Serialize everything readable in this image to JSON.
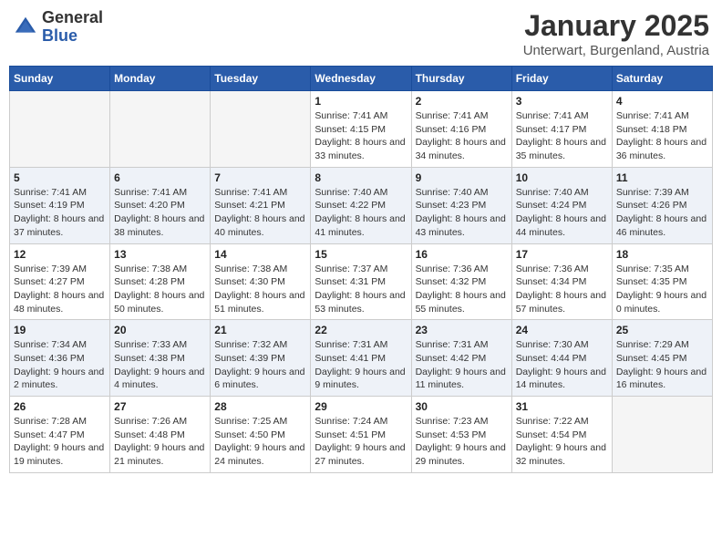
{
  "header": {
    "logo_general": "General",
    "logo_blue": "Blue",
    "title": "January 2025",
    "subtitle": "Unterwart, Burgenland, Austria"
  },
  "weekdays": [
    "Sunday",
    "Monday",
    "Tuesday",
    "Wednesday",
    "Thursday",
    "Friday",
    "Saturday"
  ],
  "weeks": [
    [
      {
        "day": "",
        "sunrise": "",
        "sunset": "",
        "daylight": ""
      },
      {
        "day": "",
        "sunrise": "",
        "sunset": "",
        "daylight": ""
      },
      {
        "day": "",
        "sunrise": "",
        "sunset": "",
        "daylight": ""
      },
      {
        "day": "1",
        "sunrise": "Sunrise: 7:41 AM",
        "sunset": "Sunset: 4:15 PM",
        "daylight": "Daylight: 8 hours and 33 minutes."
      },
      {
        "day": "2",
        "sunrise": "Sunrise: 7:41 AM",
        "sunset": "Sunset: 4:16 PM",
        "daylight": "Daylight: 8 hours and 34 minutes."
      },
      {
        "day": "3",
        "sunrise": "Sunrise: 7:41 AM",
        "sunset": "Sunset: 4:17 PM",
        "daylight": "Daylight: 8 hours and 35 minutes."
      },
      {
        "day": "4",
        "sunrise": "Sunrise: 7:41 AM",
        "sunset": "Sunset: 4:18 PM",
        "daylight": "Daylight: 8 hours and 36 minutes."
      }
    ],
    [
      {
        "day": "5",
        "sunrise": "Sunrise: 7:41 AM",
        "sunset": "Sunset: 4:19 PM",
        "daylight": "Daylight: 8 hours and 37 minutes."
      },
      {
        "day": "6",
        "sunrise": "Sunrise: 7:41 AM",
        "sunset": "Sunset: 4:20 PM",
        "daylight": "Daylight: 8 hours and 38 minutes."
      },
      {
        "day": "7",
        "sunrise": "Sunrise: 7:41 AM",
        "sunset": "Sunset: 4:21 PM",
        "daylight": "Daylight: 8 hours and 40 minutes."
      },
      {
        "day": "8",
        "sunrise": "Sunrise: 7:40 AM",
        "sunset": "Sunset: 4:22 PM",
        "daylight": "Daylight: 8 hours and 41 minutes."
      },
      {
        "day": "9",
        "sunrise": "Sunrise: 7:40 AM",
        "sunset": "Sunset: 4:23 PM",
        "daylight": "Daylight: 8 hours and 43 minutes."
      },
      {
        "day": "10",
        "sunrise": "Sunrise: 7:40 AM",
        "sunset": "Sunset: 4:24 PM",
        "daylight": "Daylight: 8 hours and 44 minutes."
      },
      {
        "day": "11",
        "sunrise": "Sunrise: 7:39 AM",
        "sunset": "Sunset: 4:26 PM",
        "daylight": "Daylight: 8 hours and 46 minutes."
      }
    ],
    [
      {
        "day": "12",
        "sunrise": "Sunrise: 7:39 AM",
        "sunset": "Sunset: 4:27 PM",
        "daylight": "Daylight: 8 hours and 48 minutes."
      },
      {
        "day": "13",
        "sunrise": "Sunrise: 7:38 AM",
        "sunset": "Sunset: 4:28 PM",
        "daylight": "Daylight: 8 hours and 50 minutes."
      },
      {
        "day": "14",
        "sunrise": "Sunrise: 7:38 AM",
        "sunset": "Sunset: 4:30 PM",
        "daylight": "Daylight: 8 hours and 51 minutes."
      },
      {
        "day": "15",
        "sunrise": "Sunrise: 7:37 AM",
        "sunset": "Sunset: 4:31 PM",
        "daylight": "Daylight: 8 hours and 53 minutes."
      },
      {
        "day": "16",
        "sunrise": "Sunrise: 7:36 AM",
        "sunset": "Sunset: 4:32 PM",
        "daylight": "Daylight: 8 hours and 55 minutes."
      },
      {
        "day": "17",
        "sunrise": "Sunrise: 7:36 AM",
        "sunset": "Sunset: 4:34 PM",
        "daylight": "Daylight: 8 hours and 57 minutes."
      },
      {
        "day": "18",
        "sunrise": "Sunrise: 7:35 AM",
        "sunset": "Sunset: 4:35 PM",
        "daylight": "Daylight: 9 hours and 0 minutes."
      }
    ],
    [
      {
        "day": "19",
        "sunrise": "Sunrise: 7:34 AM",
        "sunset": "Sunset: 4:36 PM",
        "daylight": "Daylight: 9 hours and 2 minutes."
      },
      {
        "day": "20",
        "sunrise": "Sunrise: 7:33 AM",
        "sunset": "Sunset: 4:38 PM",
        "daylight": "Daylight: 9 hours and 4 minutes."
      },
      {
        "day": "21",
        "sunrise": "Sunrise: 7:32 AM",
        "sunset": "Sunset: 4:39 PM",
        "daylight": "Daylight: 9 hours and 6 minutes."
      },
      {
        "day": "22",
        "sunrise": "Sunrise: 7:31 AM",
        "sunset": "Sunset: 4:41 PM",
        "daylight": "Daylight: 9 hours and 9 minutes."
      },
      {
        "day": "23",
        "sunrise": "Sunrise: 7:31 AM",
        "sunset": "Sunset: 4:42 PM",
        "daylight": "Daylight: 9 hours and 11 minutes."
      },
      {
        "day": "24",
        "sunrise": "Sunrise: 7:30 AM",
        "sunset": "Sunset: 4:44 PM",
        "daylight": "Daylight: 9 hours and 14 minutes."
      },
      {
        "day": "25",
        "sunrise": "Sunrise: 7:29 AM",
        "sunset": "Sunset: 4:45 PM",
        "daylight": "Daylight: 9 hours and 16 minutes."
      }
    ],
    [
      {
        "day": "26",
        "sunrise": "Sunrise: 7:28 AM",
        "sunset": "Sunset: 4:47 PM",
        "daylight": "Daylight: 9 hours and 19 minutes."
      },
      {
        "day": "27",
        "sunrise": "Sunrise: 7:26 AM",
        "sunset": "Sunset: 4:48 PM",
        "daylight": "Daylight: 9 hours and 21 minutes."
      },
      {
        "day": "28",
        "sunrise": "Sunrise: 7:25 AM",
        "sunset": "Sunset: 4:50 PM",
        "daylight": "Daylight: 9 hours and 24 minutes."
      },
      {
        "day": "29",
        "sunrise": "Sunrise: 7:24 AM",
        "sunset": "Sunset: 4:51 PM",
        "daylight": "Daylight: 9 hours and 27 minutes."
      },
      {
        "day": "30",
        "sunrise": "Sunrise: 7:23 AM",
        "sunset": "Sunset: 4:53 PM",
        "daylight": "Daylight: 9 hours and 29 minutes."
      },
      {
        "day": "31",
        "sunrise": "Sunrise: 7:22 AM",
        "sunset": "Sunset: 4:54 PM",
        "daylight": "Daylight: 9 hours and 32 minutes."
      },
      {
        "day": "",
        "sunrise": "",
        "sunset": "",
        "daylight": ""
      }
    ]
  ]
}
